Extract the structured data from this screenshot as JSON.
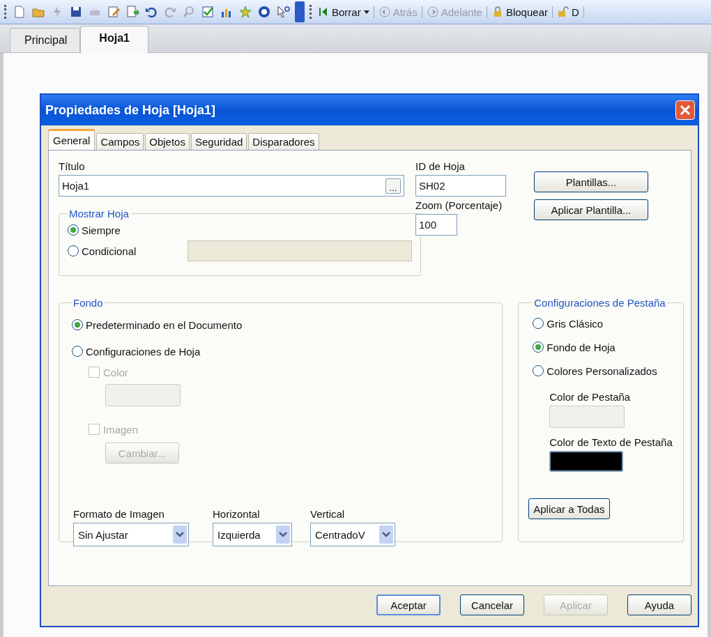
{
  "toolbar": {
    "buttons": [
      {
        "label": "Borrar",
        "disabled": false,
        "kind": "clear",
        "caret": true
      },
      {
        "label": "Atrás",
        "disabled": true,
        "kind": "back",
        "caret": false
      },
      {
        "label": "Adelante",
        "disabled": true,
        "kind": "forward",
        "caret": false
      },
      {
        "label": "Bloquear",
        "disabled": false,
        "kind": "lock",
        "caret": false
      },
      {
        "label": "D",
        "disabled": false,
        "kind": "unlock",
        "caret": false
      }
    ]
  },
  "sheet_tabs": [
    {
      "label": "Principal",
      "selected": false
    },
    {
      "label": "Hoja1",
      "selected": true
    }
  ],
  "dialog": {
    "title": "Propiedades de Hoja [Hoja1]",
    "tabs": [
      {
        "label": "General",
        "selected": true
      },
      {
        "label": "Campos",
        "selected": false
      },
      {
        "label": "Objetos",
        "selected": false
      },
      {
        "label": "Seguridad",
        "selected": false
      },
      {
        "label": "Disparadores",
        "selected": false
      }
    ],
    "titulo": {
      "label": "Título",
      "value": "Hoja1",
      "browse": "..."
    },
    "id_de_hoja": {
      "label": "ID de Hoja",
      "value": "SH02"
    },
    "zoom": {
      "label": "Zoom (Porcentaje)",
      "value": "100"
    },
    "template_buttons": [
      "Plantillas...",
      "Aplicar Plantilla..."
    ],
    "mostrar_hoja": {
      "legend": "Mostrar Hoja",
      "options": [
        {
          "label": "Siempre",
          "selected": true
        },
        {
          "label": "Condicional",
          "selected": false
        }
      ]
    },
    "fondo": {
      "legend": "Fondo",
      "options": [
        {
          "label": "Predeterminado en el Documento",
          "selected": true
        },
        {
          "label": "Configuraciones de Hoja",
          "selected": false
        }
      ],
      "color": {
        "label": "Color",
        "checked": false,
        "disabled": true
      },
      "imagen": {
        "label": "Imagen",
        "checked": false,
        "disabled": true
      },
      "cambiar": {
        "label": "Cambiar...",
        "disabled": true
      },
      "dropdowns": [
        {
          "label": "Formato de Imagen",
          "value": "Sin Ajustar"
        },
        {
          "label": "Horizontal",
          "value": "Izquierda"
        },
        {
          "label": "Vertical",
          "value": "CentradoV"
        }
      ]
    },
    "tab_config": {
      "legend": "Configuraciones de Pestaña",
      "options": [
        {
          "label": "Gris Clásico",
          "selected": false
        },
        {
          "label": "Fondo de Hoja",
          "selected": true
        },
        {
          "label": "Colores Personalizados",
          "selected": false
        }
      ],
      "tab_color_label": "Color de Pestaña",
      "text_color": {
        "label": "Color de Texto de Pestaña",
        "color": "#000000"
      },
      "apply_all": "Aplicar a Todas"
    },
    "footer_buttons": [
      {
        "label": "Aceptar",
        "disabled": false,
        "default": true
      },
      {
        "label": "Cancelar",
        "disabled": false,
        "default": false
      },
      {
        "label": "Aplicar",
        "disabled": true,
        "default": false
      },
      {
        "label": "Ayuda",
        "disabled": false,
        "default": false
      }
    ]
  }
}
